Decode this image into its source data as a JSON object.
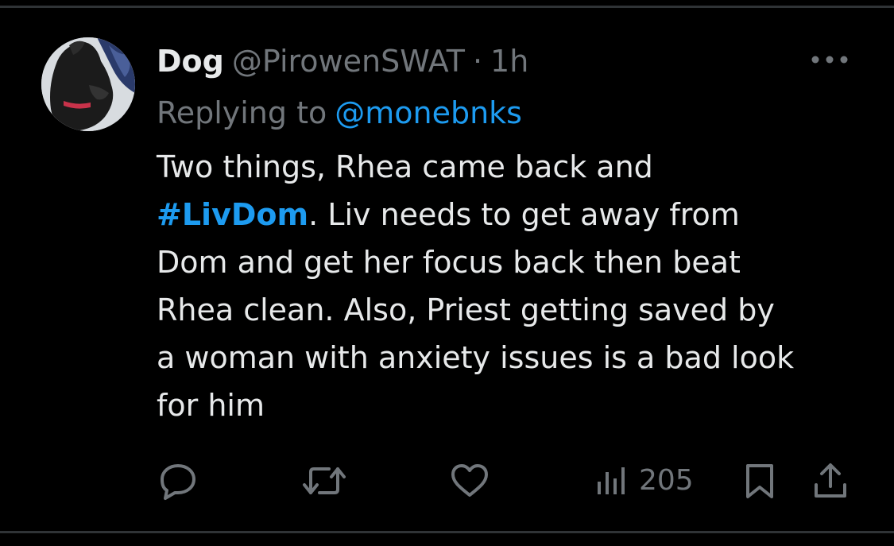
{
  "tweet": {
    "author": {
      "display_name": "Dog",
      "handle": "@PirowenSWAT",
      "separator": "·",
      "time": "1h"
    },
    "reply": {
      "prefix": "Replying to",
      "handle": "@monebnks"
    },
    "body_lines": [
      {
        "before": "Two things,  Rhea came back and",
        "hashtag": "",
        "after": ""
      },
      {
        "before": "",
        "hashtag": "#LivDom",
        "after": ".  Liv needs to get away from"
      },
      {
        "before": "Dom and get her focus back then beat",
        "hashtag": "",
        "after": ""
      },
      {
        "before": "Rhea clean.  Also,  Priest getting saved by",
        "hashtag": "",
        "after": ""
      },
      {
        "before": "a woman with anxiety issues is a bad look",
        "hashtag": "",
        "after": ""
      },
      {
        "before": "for him",
        "hashtag": "",
        "after": ""
      }
    ],
    "actions": {
      "reply_icon": "reply-icon",
      "retweet_icon": "retweet-icon",
      "like_icon": "heart-icon",
      "views_icon": "views-icon",
      "views_count": "205",
      "bookmark_icon": "bookmark-icon",
      "share_icon": "share-icon"
    }
  },
  "colors": {
    "background": "#000000",
    "text": "#e7e9ea",
    "muted": "#71767b",
    "accent": "#1d9bf0",
    "divider": "#2f3336"
  }
}
